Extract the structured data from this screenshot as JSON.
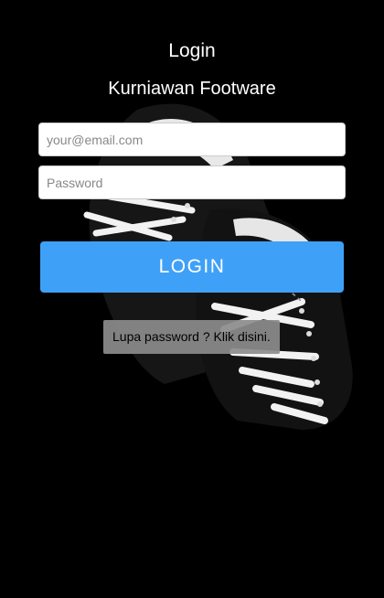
{
  "header": {
    "title": "Login",
    "subtitle": "Kurniawan Footware"
  },
  "form": {
    "email_placeholder": "your@email.com",
    "email_value": "",
    "password_placeholder": "Password",
    "password_value": "",
    "login_label": "LOGIN",
    "forgot_label": "Lupa password ? Klik disini."
  },
  "colors": {
    "background": "#000000",
    "login_button": "#3fa0f7",
    "forgot_box": "#8c8c8c"
  },
  "icons": {
    "background_image": "sneakers-image"
  }
}
